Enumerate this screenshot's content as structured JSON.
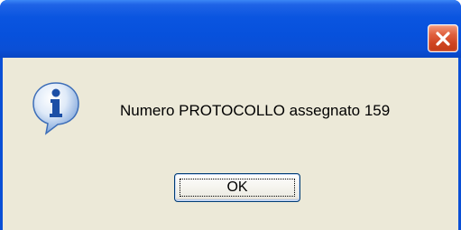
{
  "dialog": {
    "message": "Numero PROTOCOLLO assegnato 159",
    "ok_label": "OK",
    "icon": "info-icon",
    "close_icon": "close-icon"
  },
  "colors": {
    "titlebar": "#0a55e0",
    "client": "#ece9d8",
    "close_button": "#e0603e"
  }
}
